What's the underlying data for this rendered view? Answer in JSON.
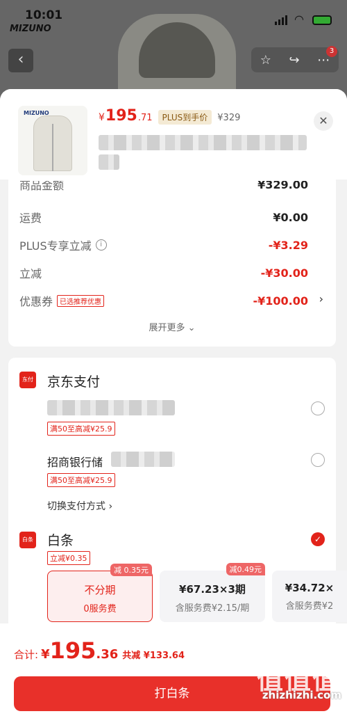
{
  "status_bar": {
    "time": "10:01",
    "brand": "MIZUNO"
  },
  "top_actions": {
    "badge_count": "3"
  },
  "product": {
    "price_symbol": "¥",
    "price_int": "195",
    "price_dec": ".71",
    "plus_tag": "PLUS到手价",
    "original_price": "¥329",
    "thumb_logo": "MIZUNO"
  },
  "cost": {
    "partial_label": "商品金额",
    "partial_value": "¥329.00",
    "rows": [
      {
        "label": "运费",
        "value": "¥0.00"
      },
      {
        "label": "PLUS专享立减",
        "value": "-¥3.29"
      },
      {
        "label": "立减",
        "value": "-¥30.00"
      },
      {
        "label": "优惠券",
        "tag": "已选推荐优惠",
        "value": "-¥100.00"
      }
    ],
    "expand_more": "展开更多 ⌄"
  },
  "payment": {
    "jd_pay_title": "京东支付",
    "jd_pay_icon_text": "东付",
    "bank1_promo": "满50至高减¥25.9",
    "bank2_name": "招商银行储",
    "bank2_promo": "满50至高减¥25.9",
    "switch_method": "切换支付方式 ›",
    "baitiao_title": "白条",
    "baitiao_icon_text": "白条",
    "baitiao_promo": "立减¥0.35",
    "plans": [
      {
        "main": "不分期",
        "sub": "0服务费",
        "badge": "减 0.35元"
      },
      {
        "main": "¥67.23×3期",
        "sub": "含服务费¥2.15/期",
        "badge": "减0.49元"
      },
      {
        "main": "¥34.72×",
        "sub": "含服务费¥2",
        "badge": ""
      }
    ]
  },
  "bottom": {
    "total_label": "合计:",
    "total_symbol": "¥",
    "total_int": "195",
    "total_dec": ".36",
    "saved": "共减 ¥133.64",
    "pay_button": "打白条"
  },
  "watermark": {
    "glyphs": "值值值",
    "site": "zhizhizhi.com"
  }
}
